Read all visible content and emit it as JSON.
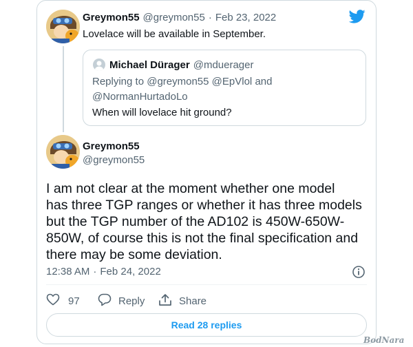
{
  "quoted_tweet": {
    "author_name": "Greymon55",
    "author_handle": "@greymon55",
    "separator": "·",
    "date": "Feb 23, 2022",
    "text": "Lovelace will be available in September."
  },
  "reply_context": {
    "author_name": "Michael Dürager",
    "author_handle": "@mduerager",
    "replying_prefix": "Replying to",
    "replying_to_1": "@greymon55",
    "replying_to_2": "@EpVlol",
    "replying_and": "and",
    "replying_to_3": "@NormanHurtadoLo",
    "text": "When will lovelace hit ground?"
  },
  "main_tweet": {
    "author_name": "Greymon55",
    "author_handle": "@greymon55",
    "text_lines": [
      "I am not clear at the moment whether one model",
      "has three TGP ranges or whether it has three models",
      "but the TGP number of the AD102 is 450W-650W-",
      "850W, of course this is not the final specification and",
      "there may be some deviation."
    ],
    "time": "12:38 AM",
    "separator": "·",
    "date": "Feb 24, 2022"
  },
  "actions": {
    "like_count": "97",
    "reply_label": "Reply",
    "share_label": "Share"
  },
  "read_replies_label": "Read 28 replies",
  "watermark": "BodNara",
  "icons": {
    "platform": "twitter-bird-icon",
    "info": "info-icon",
    "like": "heart-icon",
    "reply": "speech-bubble-icon",
    "share": "share-upload-icon"
  },
  "colors": {
    "accent": "#1d9bf0",
    "text": "#0f1419",
    "muted": "#536471",
    "border": "#cfd9de"
  }
}
